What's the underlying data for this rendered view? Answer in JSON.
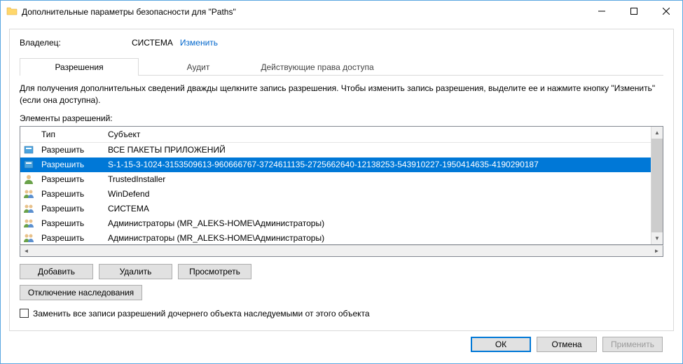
{
  "window": {
    "title": "Дополнительные параметры безопасности  для \"Paths\""
  },
  "owner": {
    "label": "Владелец:",
    "value": "СИСТЕМА",
    "change_link": "Изменить"
  },
  "tabs": {
    "permissions": "Разрешения",
    "audit": "Аудит",
    "effective": "Действующие права доступа"
  },
  "info_text": "Для получения дополнительных сведений дважды щелкните запись разрешения. Чтобы изменить запись разрешения, выделите ее и нажмите кнопку \"Изменить\" (если она доступна).",
  "list": {
    "label": "Элементы разрешений:",
    "headers": {
      "type": "Тип",
      "subject": "Субъект"
    },
    "rows": [
      {
        "type": "Разрешить",
        "subject": "ВСЕ ПАКЕТЫ ПРИЛОЖЕНИЙ",
        "icon": "package",
        "selected": false
      },
      {
        "type": "Разрешить",
        "subject": "S-1-15-3-1024-3153509613-960666767-3724611135-2725662640-12138253-543910227-1950414635-4190290187",
        "icon": "package",
        "selected": true
      },
      {
        "type": "Разрешить",
        "subject": "TrustedInstaller",
        "icon": "user",
        "selected": false
      },
      {
        "type": "Разрешить",
        "subject": "WinDefend",
        "icon": "group",
        "selected": false
      },
      {
        "type": "Разрешить",
        "subject": "СИСТЕМА",
        "icon": "group",
        "selected": false
      },
      {
        "type": "Разрешить",
        "subject": "Администраторы (MR_ALEKS-HOME\\Администраторы)",
        "icon": "group",
        "selected": false
      },
      {
        "type": "Разрешить",
        "subject": "Администраторы (MR_ALEKS-HOME\\Администраторы)",
        "icon": "group",
        "selected": false
      }
    ]
  },
  "buttons": {
    "add": "Добавить",
    "remove": "Удалить",
    "view": "Просмотреть",
    "disable_inherit": "Отключение наследования"
  },
  "checkbox": {
    "label": "Заменить все записи разрешений дочернего объекта наследуемыми от этого объекта"
  },
  "dialog_buttons": {
    "ok": "ОК",
    "cancel": "Отмена",
    "apply": "Применить"
  }
}
